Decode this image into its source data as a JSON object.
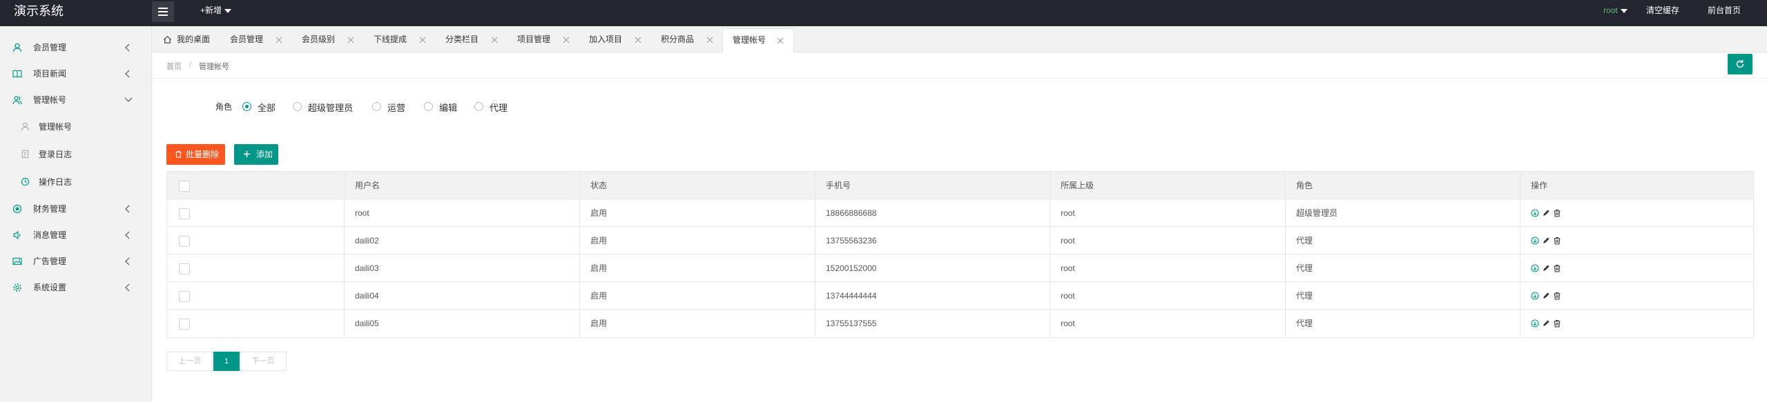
{
  "app": {
    "title": "演示系统"
  },
  "header": {
    "menu_icon": "hamburger-icon",
    "new_label": "+新增",
    "user_name": "root",
    "clear_cache": "清空缓存",
    "front_home": "前台首页"
  },
  "sidebar": {
    "items": [
      {
        "label": "会员管理",
        "icon": "user-icon"
      },
      {
        "label": "项目新闻",
        "icon": "book-icon"
      },
      {
        "label": "管理帐号",
        "icon": "users-icon"
      },
      {
        "label": "财务管理",
        "icon": "coin-icon"
      },
      {
        "label": "消息管理",
        "icon": "speaker-icon"
      },
      {
        "label": "广告管理",
        "icon": "image-icon"
      },
      {
        "label": "系统设置",
        "icon": "gear-icon"
      }
    ],
    "sub_items": [
      {
        "label": "管理帐号",
        "icon": "user-icon"
      },
      {
        "label": "登录日志",
        "icon": "doc-icon"
      },
      {
        "label": "操作日志",
        "icon": "clock-icon"
      }
    ]
  },
  "tabs": [
    {
      "label": "我的桌面"
    },
    {
      "label": "会员管理"
    },
    {
      "label": "会员级别"
    },
    {
      "label": "下线提成"
    },
    {
      "label": "分类栏目"
    },
    {
      "label": "项目管理"
    },
    {
      "label": "加入项目"
    },
    {
      "label": "积分商品"
    },
    {
      "label": "管理帐号"
    }
  ],
  "breadcrumb": {
    "home": "首页",
    "separator": "/",
    "current": "管理帐号"
  },
  "filter": {
    "label": "角色",
    "options": [
      "全部",
      "超级管理员",
      "运营",
      "编辑",
      "代理"
    ],
    "selected": "全部"
  },
  "actions": {
    "batch_delete": "批量删除",
    "add": "添加"
  },
  "table": {
    "columns": [
      "用户名",
      "状态",
      "手机号",
      "所属上级",
      "角色",
      "操作"
    ],
    "rows": [
      {
        "username": "root",
        "status": "启用",
        "phone": "18866886688",
        "parent": "root",
        "role": "超级管理员"
      },
      {
        "username": "daili02",
        "status": "启用",
        "phone": "13755563236",
        "parent": "root",
        "role": "代理"
      },
      {
        "username": "daili03",
        "status": "启用",
        "phone": "15200152000",
        "parent": "root",
        "role": "代理"
      },
      {
        "username": "daili04",
        "status": "启用",
        "phone": "13744444444",
        "parent": "root",
        "role": "代理"
      },
      {
        "username": "daili05",
        "status": "启用",
        "phone": "13755137555",
        "parent": "root",
        "role": "代理"
      }
    ]
  },
  "pagination": {
    "prev": "上一页",
    "current": "1",
    "next": "下一页"
  },
  "colors": {
    "accent": "#009688",
    "danger": "#ff5722",
    "header_bg": "#23262e",
    "user_green": "#5fb878"
  }
}
